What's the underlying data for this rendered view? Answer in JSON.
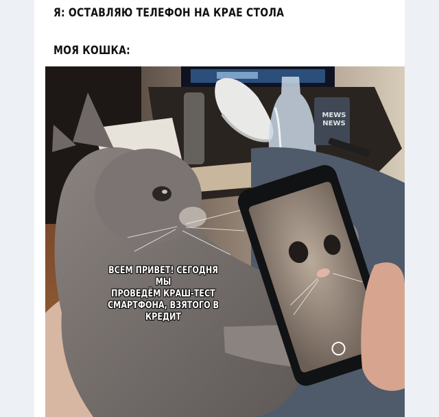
{
  "meme": {
    "top_caption": "Я: ОСТАВЛЯЮ ТЕЛЕФОН НА КРАЕ СТОЛА",
    "second_caption": "МОЯ КОШКА:",
    "overlay_lines": [
      "ВСЕМ ПРИВЕТ! СЕГОДНЯ МЫ",
      "ПРОВЕДЁМ КРАШ-ТЕСТ",
      "СМАРТФОНА, ВЗЯТОГО В",
      "КРЕДИТ"
    ],
    "mug_lines": [
      "MEWS",
      "NEWS"
    ]
  },
  "colors": {
    "page_background": "#edf1f5",
    "post_background": "#ffffff",
    "caption_text": "#111111",
    "overlay_text": "#ffffff",
    "overlay_outline": "#000000",
    "cat_fur": "#7d7673"
  },
  "icons": [
    "cat-photo",
    "smartphone",
    "bottle",
    "sneaker",
    "tv"
  ]
}
